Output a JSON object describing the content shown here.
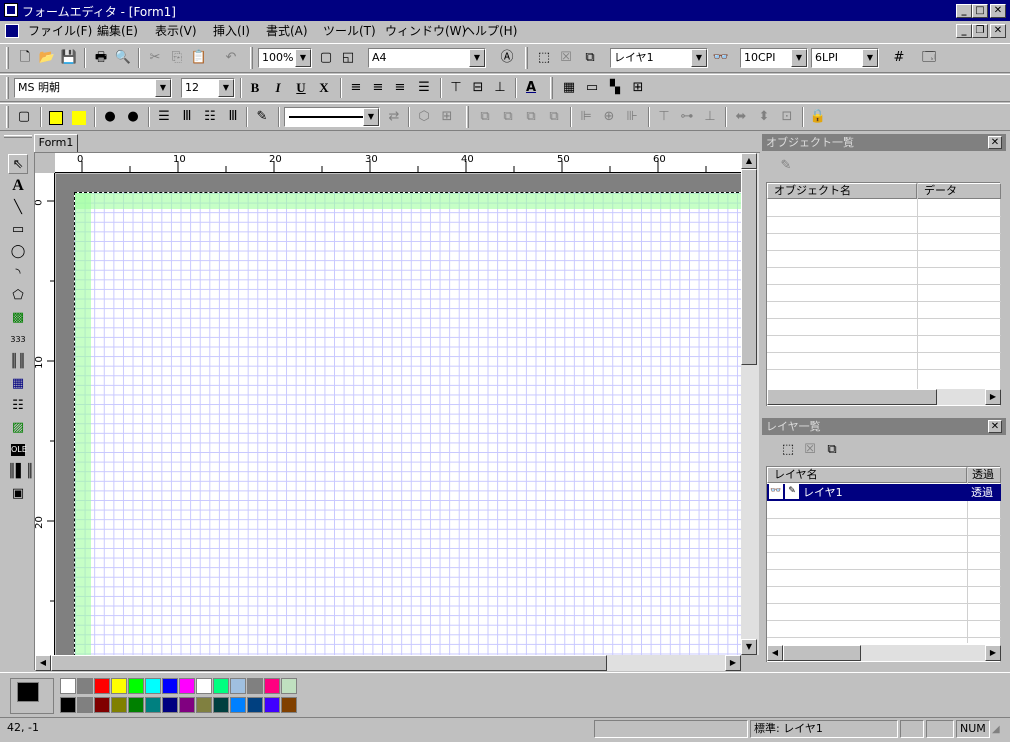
{
  "window": {
    "title": "フォームエディタ - [Form1]"
  },
  "menu": [
    "ファイル(F)",
    "編集(E)",
    "表示(V)",
    "挿入(I)",
    "書式(A)",
    "ツール(T)",
    "ウィンドウ(W)",
    "ヘルプ(H)"
  ],
  "toolbar1": {
    "zoom": "100%",
    "paper": "A4",
    "layer": "レイヤ1",
    "cpi": "10CPI",
    "lpi": "6LPI"
  },
  "toolbar2": {
    "font": "MS 明朝",
    "size": "12",
    "bold": "B",
    "italic": "I",
    "underline": "U",
    "strike": "X"
  },
  "tab": {
    "label": "Form1"
  },
  "ruler": {
    "h": [
      "0",
      "10",
      "20",
      "30",
      "40",
      "50",
      "60"
    ],
    "v": [
      "0",
      "10",
      "20"
    ]
  },
  "objects_panel": {
    "title": "オブジェクト一覧",
    "col_name": "オブジェクト名",
    "col_data": "データ"
  },
  "layers_panel": {
    "title": "レイヤ一覧",
    "col_name": "レイヤ名",
    "col_trans": "透過",
    "rows": [
      {
        "name": "レイヤ1",
        "trans": "透過"
      }
    ]
  },
  "palette": {
    "row1": [
      "#ffffff",
      "#808080",
      "#ff0000",
      "#ffff00",
      "#00ff00",
      "#00ffff",
      "#0000ff",
      "#ff00ff",
      "#ffffff",
      "#00ff80",
      "#a0c0e0",
      "#808080",
      "#ff0080",
      "#c0e0c0"
    ],
    "row2": [
      "#000000",
      "#808080",
      "#800000",
      "#808000",
      "#008000",
      "#008080",
      "#000080",
      "#800080",
      "#808040",
      "#004040",
      "#0080ff",
      "#004080",
      "#4000ff",
      "#804000"
    ]
  },
  "status": {
    "coords": "42, -1",
    "layer": "標準: レイヤ1",
    "num": "NUM"
  }
}
